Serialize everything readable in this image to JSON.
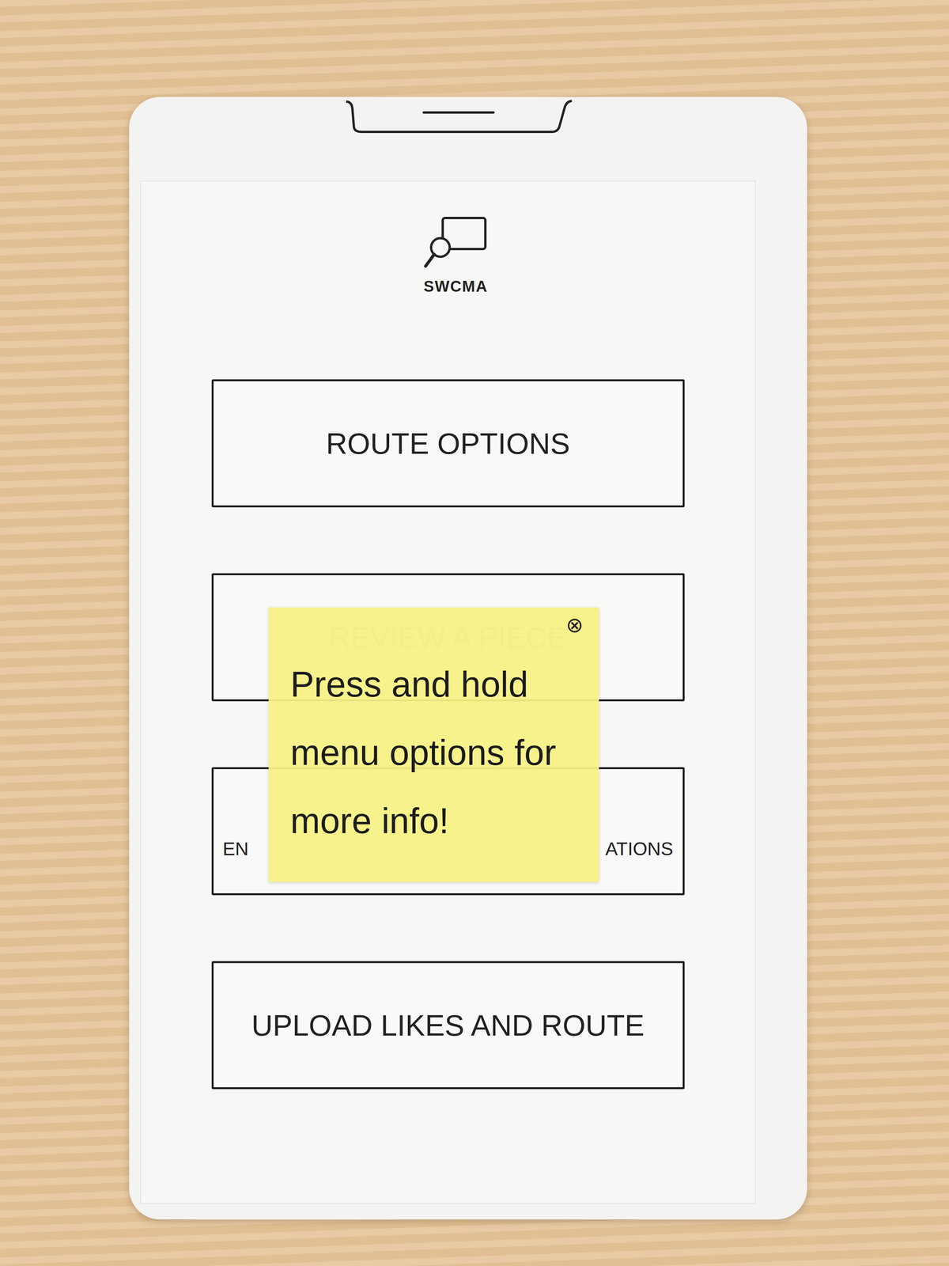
{
  "app": {
    "logo_text": "SWCMA"
  },
  "menu": [
    {
      "kind": "full",
      "label": "ROUTE OPTIONS",
      "faded": false
    },
    {
      "kind": "full",
      "label": "REVIEW A PIECE",
      "faded": true
    },
    {
      "kind": "split",
      "label_start": "EN",
      "label_end": "ATIONS",
      "faded": false
    },
    {
      "kind": "full",
      "label": "UPLOAD LIKES AND ROUTE",
      "faded": false
    }
  ],
  "tooltip": {
    "text": "Press and hold menu options for more info!",
    "close": "⊗"
  }
}
